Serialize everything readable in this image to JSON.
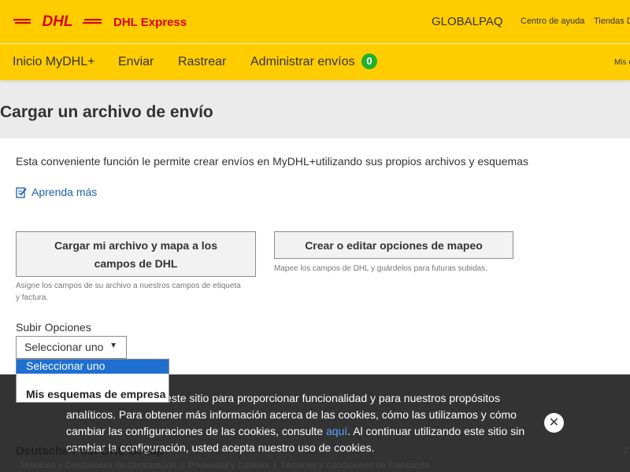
{
  "header": {
    "brand_logo_text": "DHL",
    "brand_text": "DHL Express",
    "account_name": "GLOBALPAQ",
    "help_link": "Centro de ayuda",
    "stores_link": "Tiendas D",
    "colors": {
      "brand_yellow": "#ffcc00",
      "brand_red": "#d40511",
      "badge_green": "#1db12e"
    }
  },
  "nav": {
    "items": [
      "Inicio MyDHL+",
      "Enviar",
      "Rastrear",
      "Administrar envíos"
    ],
    "badge_count": "0",
    "right_label": "Mis c"
  },
  "page": {
    "title": "Cargar un archivo de envío",
    "intro": "Esta conveniente función le permite crear envíos en MyDHL+utilizando sus propios archivos y esquemas",
    "learn_more": "Aprenda más",
    "learn_more_icon": "edit-note-icon",
    "upload_button": "Cargar mi archivo y mapa a los campos de DHL",
    "upload_hint": "Asigne los campos de su archivo a nuestros campos de etiqueta y factura.",
    "mapping_button": "Crear o editar opciones de mapeo",
    "mapping_hint": "Mapee los campos de DHL y guárdelos para futuras subidas.",
    "options_label": "Subir Opciones",
    "select_value": "Seleccionar uno"
  },
  "dropdown": {
    "options": [
      "Seleccionar uno",
      "Mis esquemas de empresa"
    ],
    "selected_index": 0
  },
  "cookie": {
    "text_before": "Usamos cookies en este sitio para proporcionar funcionalidad y para nuestros propósitos analíticos. Para obtener más información acerca de las cookies, cómo las utilizamos y cómo cambiar las configuraciones de las cookies, consulte ",
    "link": "aquí",
    "text_after": ". Al continuar utilizando este sitio sin cambiar la configuración, usted acepta nuestro uso de cookies.",
    "close_icon": "close-icon"
  },
  "footer": {
    "brand": "Deutsche Post DHL Group",
    "year": "2",
    "links": [
      "Términos y Condiciones de Contratación",
      "Privacidad y Cookies",
      "Términos y Condiciones de Transporte"
    ]
  }
}
